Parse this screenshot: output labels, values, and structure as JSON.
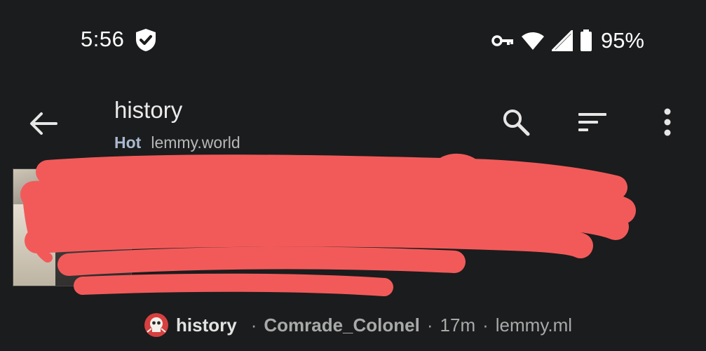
{
  "status_bar": {
    "time": "5:56",
    "battery": "95%",
    "icons": [
      "vpn-shield-icon",
      "key-icon",
      "wifi-icon",
      "signal-icon",
      "battery-icon"
    ]
  },
  "app_bar": {
    "title": "history",
    "sort": "Hot",
    "instance": "lemmy.world",
    "icons": [
      "back-arrow-icon",
      "search-icon",
      "sort-icon",
      "more-vert-icon"
    ]
  },
  "post": {
    "title": "",
    "community": "history",
    "author": "Comrade_Colonel",
    "time": "17m",
    "domain": "lemmy.ml",
    "separator": "·",
    "redaction_color": "#f25a5a"
  },
  "colors": {
    "background": "#1b1c1d",
    "text": "#ebebeb",
    "accent": "#aab9cf"
  }
}
